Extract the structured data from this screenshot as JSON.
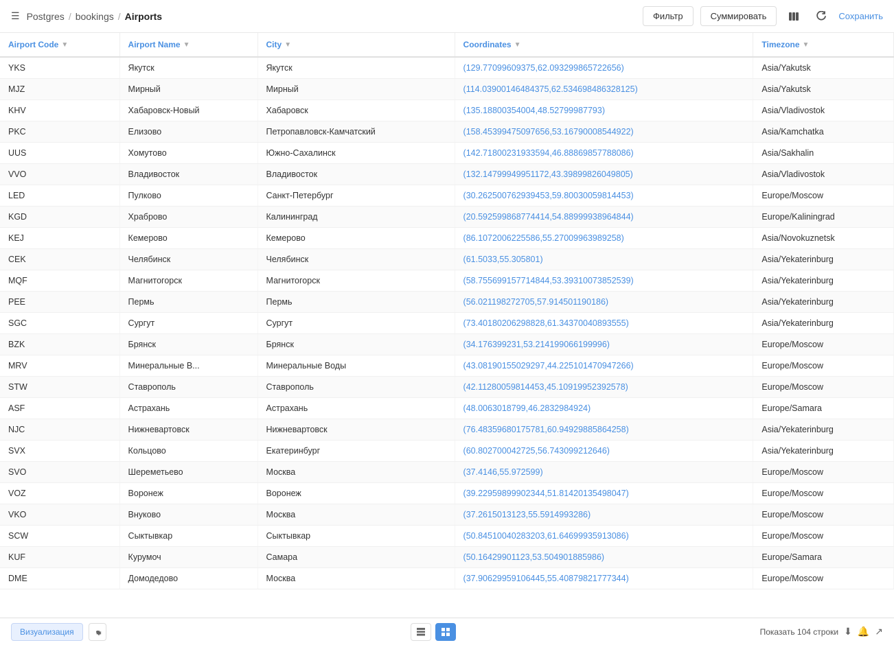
{
  "breadcrumb": {
    "db_label": "Postgres",
    "section_label": "bookings",
    "page_title": "Airports"
  },
  "toolbar": {
    "filter_label": "Фильтр",
    "summarize_label": "Суммировать",
    "save_label": "Сохранить"
  },
  "table": {
    "columns": [
      {
        "id": "code",
        "label": "Airport Code"
      },
      {
        "id": "name",
        "label": "Airport Name"
      },
      {
        "id": "city",
        "label": "City"
      },
      {
        "id": "coords",
        "label": "Coordinates"
      },
      {
        "id": "tz",
        "label": "Timezone"
      }
    ],
    "rows": [
      {
        "code": "YKS",
        "name": "Якутск",
        "city": "Якутск",
        "coords": "(129.77099609375,62.093299865722656)",
        "tz": "Asia/Yakutsk"
      },
      {
        "code": "MJZ",
        "name": "Мирный",
        "city": "Мирный",
        "coords": "(114.03900146484375,62.534698486328125)",
        "tz": "Asia/Yakutsk"
      },
      {
        "code": "KHV",
        "name": "Хабаровск-Новый",
        "city": "Хабаровск",
        "coords": "(135.18800354004,48.52799987793)",
        "tz": "Asia/Vladivostok"
      },
      {
        "code": "PKC",
        "name": "Елизово",
        "city": "Петропавловск-Камчатский",
        "coords": "(158.45399475097656,53.16790008544922)",
        "tz": "Asia/Kamchatka"
      },
      {
        "code": "UUS",
        "name": "Хомутово",
        "city": "Южно-Сахалинск",
        "coords": "(142.71800231933594,46.88869857788086)",
        "tz": "Asia/Sakhalin"
      },
      {
        "code": "VVO",
        "name": "Владивосток",
        "city": "Владивосток",
        "coords": "(132.14799949951172,43.39899826049805)",
        "tz": "Asia/Vladivostok"
      },
      {
        "code": "LED",
        "name": "Пулково",
        "city": "Санкт-Петербург",
        "coords": "(30.262500762939453,59.80030059814453)",
        "tz": "Europe/Moscow"
      },
      {
        "code": "KGD",
        "name": "Храброво",
        "city": "Калининград",
        "coords": "(20.592599868774414,54.88999938964844)",
        "tz": "Europe/Kaliningrad"
      },
      {
        "code": "KEJ",
        "name": "Кемерово",
        "city": "Кемерово",
        "coords": "(86.1072006225586,55.27009963989258)",
        "tz": "Asia/Novokuznetsk"
      },
      {
        "code": "CEK",
        "name": "Челябинск",
        "city": "Челябинск",
        "coords": "(61.5033,55.305801)",
        "tz": "Asia/Yekaterinburg"
      },
      {
        "code": "MQF",
        "name": "Магнитогорск",
        "city": "Магнитогорск",
        "coords": "(58.755699157714844,53.39310073852539)",
        "tz": "Asia/Yekaterinburg"
      },
      {
        "code": "PEE",
        "name": "Пермь",
        "city": "Пермь",
        "coords": "(56.021198272705,57.914501190186)",
        "tz": "Asia/Yekaterinburg"
      },
      {
        "code": "SGC",
        "name": "Сургут",
        "city": "Сургут",
        "coords": "(73.40180206298828,61.34370040893555)",
        "tz": "Asia/Yekaterinburg"
      },
      {
        "code": "BZK",
        "name": "Брянск",
        "city": "Брянск",
        "coords": "(34.176399231,53.214199066199996)",
        "tz": "Europe/Moscow"
      },
      {
        "code": "MRV",
        "name": "Минеральные В...",
        "city": "Минеральные Воды",
        "coords": "(43.08190155029297,44.225101470947266)",
        "tz": "Europe/Moscow"
      },
      {
        "code": "STW",
        "name": "Ставрополь",
        "city": "Ставрополь",
        "coords": "(42.11280059814453,45.10919952392578)",
        "tz": "Europe/Moscow"
      },
      {
        "code": "ASF",
        "name": "Астрахань",
        "city": "Астрахань",
        "coords": "(48.0063018799,46.2832984924)",
        "tz": "Europe/Samara"
      },
      {
        "code": "NJC",
        "name": "Нижневартовск",
        "city": "Нижневартовск",
        "coords": "(76.48359680175781,60.94929885864258)",
        "tz": "Asia/Yekaterinburg"
      },
      {
        "code": "SVX",
        "name": "Кольцово",
        "city": "Екатеринбург",
        "coords": "(60.802700042725,56.743099212646)",
        "tz": "Asia/Yekaterinburg"
      },
      {
        "code": "SVO",
        "name": "Шереметьево",
        "city": "Москва",
        "coords": "(37.4146,55.972599)",
        "tz": "Europe/Moscow"
      },
      {
        "code": "VOZ",
        "name": "Воронеж",
        "city": "Воронеж",
        "coords": "(39.22959899902344,51.81420135498047)",
        "tz": "Europe/Moscow"
      },
      {
        "code": "VKO",
        "name": "Внуково",
        "city": "Москва",
        "coords": "(37.2615013123,55.5914993286)",
        "tz": "Europe/Moscow"
      },
      {
        "code": "SCW",
        "name": "Сыктывкар",
        "city": "Сыктывкар",
        "coords": "(50.84510040283203,61.64699935913086)",
        "tz": "Europe/Moscow"
      },
      {
        "code": "KUF",
        "name": "Курумоч",
        "city": "Самара",
        "coords": "(50.16429901123,53.504901885986)",
        "tz": "Europe/Samara"
      },
      {
        "code": "DME",
        "name": "Домодедово",
        "city": "Москва",
        "coords": "(37.90629959106445,55.40879821777344)",
        "tz": "Europe/Moscow"
      }
    ]
  },
  "bottom_bar": {
    "viz_label": "Визуализация",
    "row_count_label": "Показать 104 строки"
  }
}
